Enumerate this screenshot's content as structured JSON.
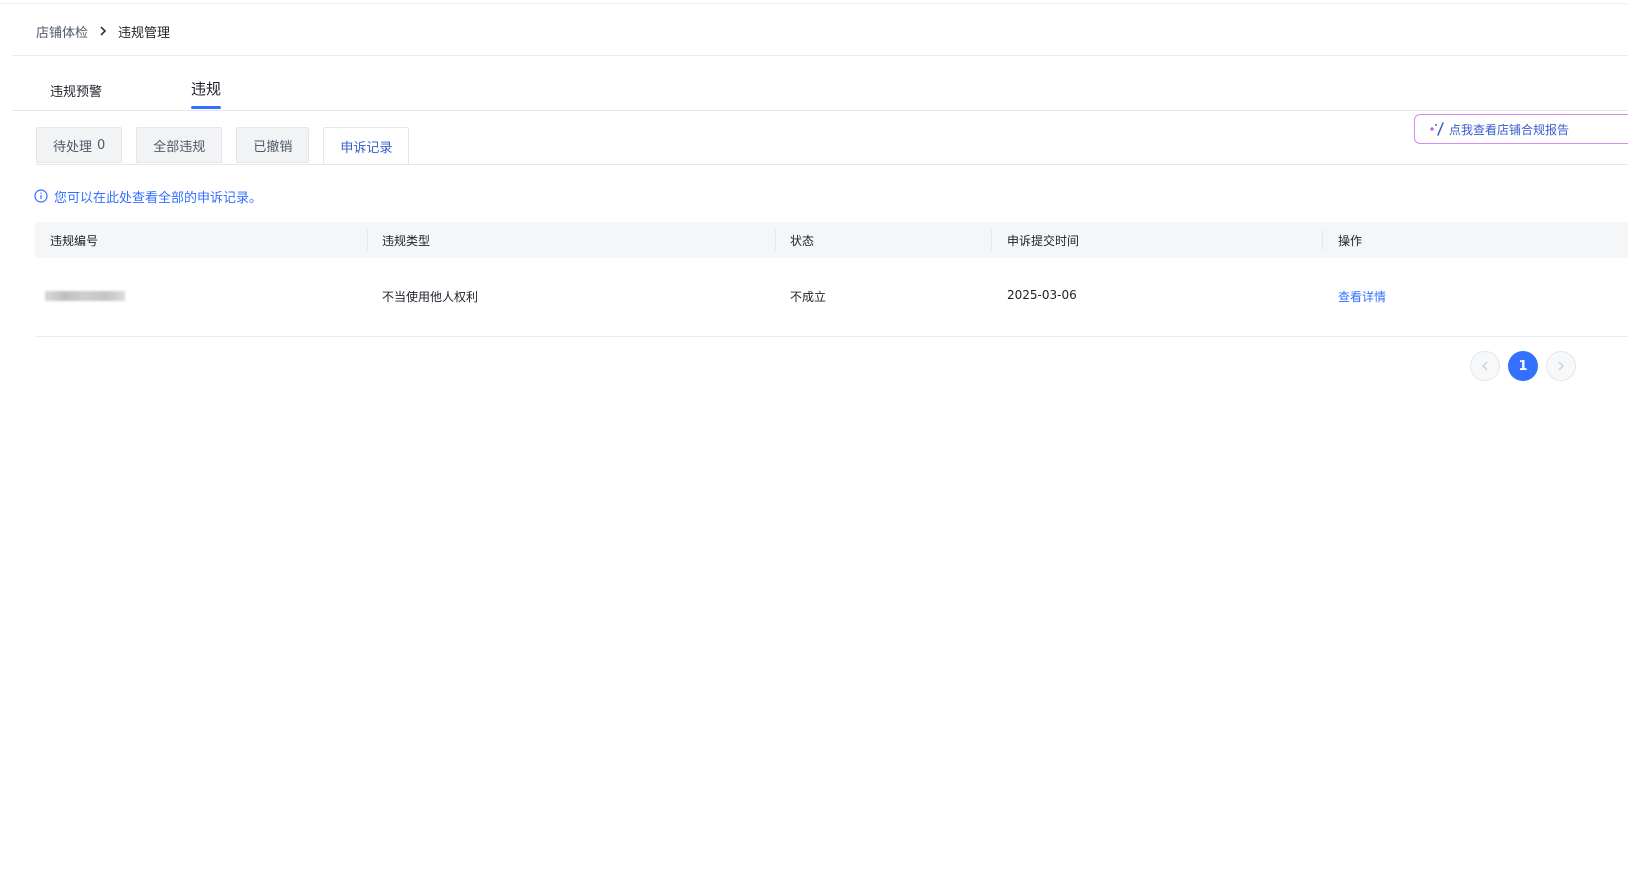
{
  "breadcrumb": {
    "parent": "店铺体检",
    "current": "违规管理"
  },
  "main_tabs": [
    {
      "label": "违规预警",
      "active": false
    },
    {
      "label": "违规",
      "active": true
    }
  ],
  "sub_tabs": [
    {
      "label": "待处理",
      "count": "0",
      "active": false
    },
    {
      "label": "全部违规",
      "active": false
    },
    {
      "label": "已撤销",
      "active": false
    },
    {
      "label": "申诉记录",
      "active": true
    }
  ],
  "report_button": {
    "label": "点我查看店铺合规报告"
  },
  "notice": {
    "text": "您可以在此处查看全部的申诉记录。"
  },
  "table": {
    "columns": [
      "违规编号",
      "违规类型",
      "状态",
      "申诉提交时间",
      "操作"
    ],
    "rows": [
      {
        "violation_type": "不当使用他人权利",
        "status": "不成立",
        "submit_time": "2025-03-06",
        "action": "查看详情"
      }
    ]
  },
  "pagination": {
    "current_page": "1"
  },
  "colors": {
    "accent": "#3370ff",
    "active_tab_text": "#3a5ccc",
    "report_border": "#d98cf0"
  }
}
